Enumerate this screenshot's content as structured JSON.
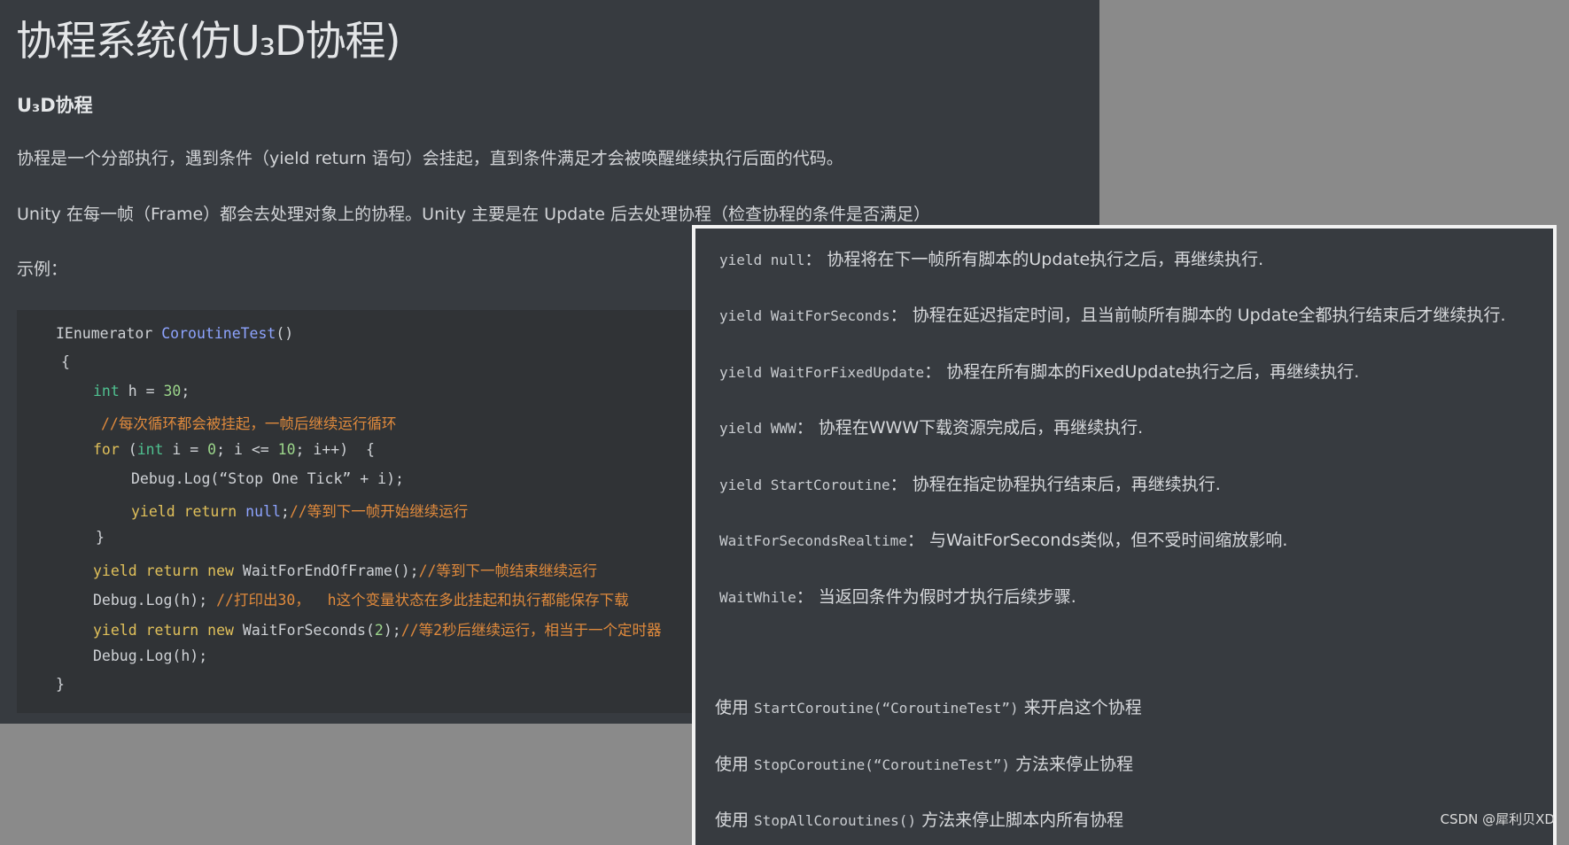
{
  "doc": {
    "title": "协程系统(仿U₃D协程)",
    "section_heading": "U₃D协程",
    "paragraphs": [
      "协程是一个分部执行，遇到条件（yield return 语句）会挂起，直到条件满足才会被唤醒继续执行后面的代码。",
      "Unity 在每一帧（Frame）都会去处理对象上的协程。Unity 主要是在 Update 后去处理协程（检查协程的条件是否满足）",
      "示例："
    ]
  },
  "code": {
    "l1": {
      "a": "IEnumerator ",
      "b": "CoroutineTest",
      "c": "()"
    },
    "l2": "{",
    "l3": {
      "a": "int",
      "b": " h = ",
      "c": "30",
      "d": ";"
    },
    "l4": "//每次循环都会被挂起，一帧后继续运行循环",
    "l5": {
      "a": "for",
      "b": " (",
      "c": "int",
      "d": " i = ",
      "e": "0",
      "f": "; i <= ",
      "g": "10",
      "h": "; i++)  {"
    },
    "l6": "Debug.Log(“Stop One Tick” + i);",
    "l7": {
      "a": "yield",
      "b": " ",
      "c": "return",
      "d": " ",
      "e": "null",
      "f": ";",
      "g": "//等到下一帧开始继续运行"
    },
    "l8": "}",
    "l9": {
      "a": "yield",
      "b": " ",
      "c": "return",
      "d": " ",
      "e": "new",
      "f": " WaitForEndOfFrame();",
      "g": "//等到下一帧结束继续运行"
    },
    "l10": {
      "a": "Debug.Log(h); ",
      "b": "//打印出30，  h这个变量状态在多此挂起和执行都能保存下载"
    },
    "l11": {
      "a": "yield",
      "b": " ",
      "c": "return",
      "d": " ",
      "e": "new",
      "f": " WaitForSeconds(",
      "g": "2",
      "h": ");",
      "i": "//等2秒后继续运行，相当于一个定时器"
    },
    "l12": "Debug.Log(h);",
    "l13": "}"
  },
  "yields": [
    {
      "code": "yield null",
      "desc": "： 协程将在下一帧所有脚本的Update执行之后，再继续执行."
    },
    {
      "code": "yield WaitForSeconds",
      "desc": "： 协程在延迟指定时间，且当前帧所有脚本的 Update全都执行结束后才继续执行."
    },
    {
      "code": "yield WaitForFixedUpdate",
      "desc": "： 协程在所有脚本的FixedUpdate执行之后，再继续执行."
    },
    {
      "code": "yield WWW",
      "desc": "： 协程在WWW下载资源完成后，再继续执行."
    },
    {
      "code": "yield StartCoroutine",
      "desc": "： 协程在指定协程执行结束后，再继续执行."
    },
    {
      "code": "WaitForSecondsRealtime",
      "desc": "： 与WaitForSeconds类似，但不受时间缩放影响."
    },
    {
      "code": "WaitWhile",
      "desc": "： 当返回条件为假时才执行后续步骤."
    }
  ],
  "usage": [
    {
      "pre": "使用 ",
      "code": "StartCoroutine(“CoroutineTest”)",
      "post": " 来开启这个协程"
    },
    {
      "pre": "使用 ",
      "code": "StopCoroutine(“CoroutineTest”)",
      "post": " 方法来停止协程"
    },
    {
      "pre": "使用 ",
      "code": "StopAllCoroutines()",
      "post": " 方法来停止脚本内所有协程"
    }
  ],
  "watermark": "CSDN @犀利贝XD"
}
